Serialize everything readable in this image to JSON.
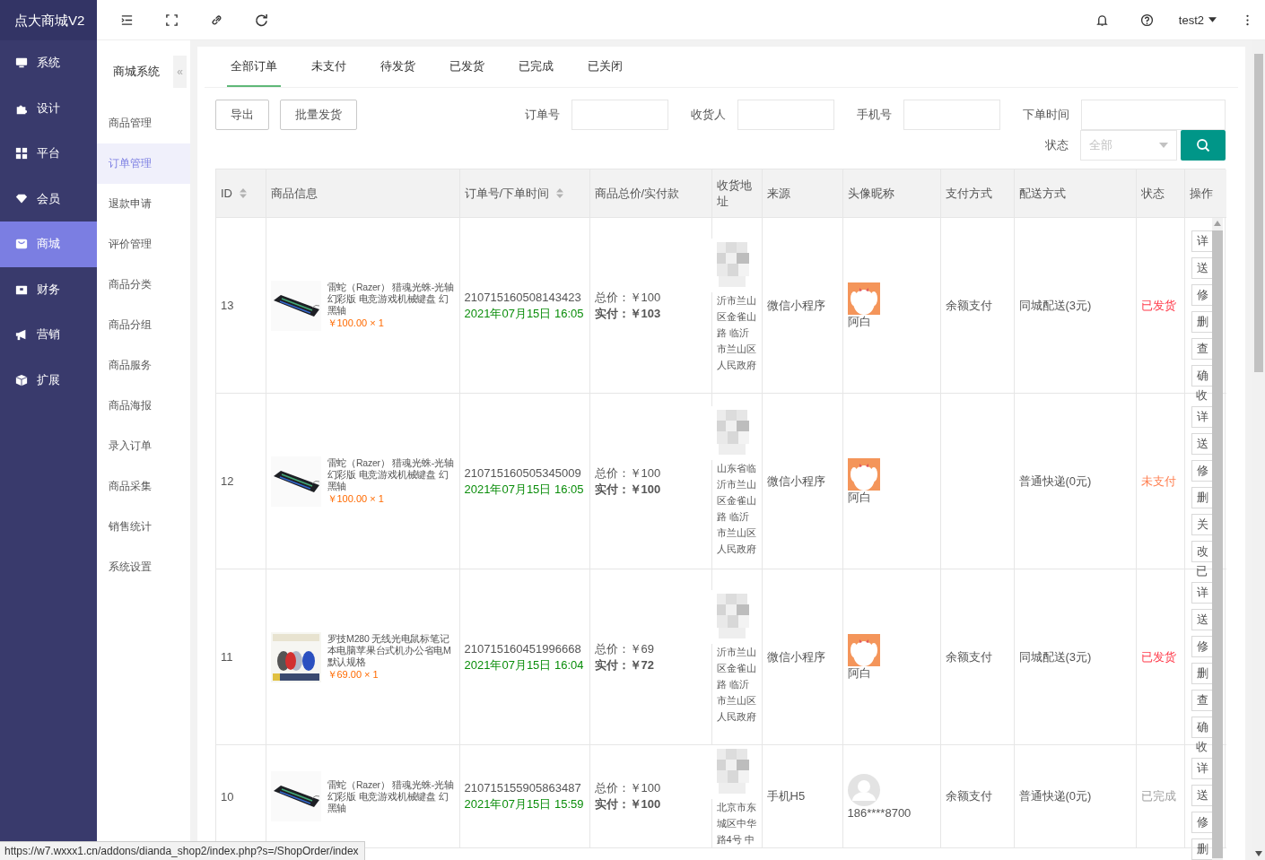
{
  "brand": "点大商城V2",
  "nav": [
    {
      "label": "系统",
      "selected": false
    },
    {
      "label": "设计",
      "selected": false
    },
    {
      "label": "平台",
      "selected": false
    },
    {
      "label": "会员",
      "selected": false
    },
    {
      "label": "商城",
      "selected": true
    },
    {
      "label": "财务",
      "selected": false
    },
    {
      "label": "营销",
      "selected": false
    },
    {
      "label": "扩展",
      "selected": false
    }
  ],
  "topbar": {
    "user": "test2"
  },
  "subnav": {
    "title": "商城系统",
    "collapse": "«",
    "items": [
      {
        "label": "商品管理",
        "selected": false
      },
      {
        "label": "订单管理",
        "selected": true
      },
      {
        "label": "退款申请",
        "selected": false
      },
      {
        "label": "评价管理",
        "selected": false
      },
      {
        "label": "商品分类",
        "selected": false
      },
      {
        "label": "商品分组",
        "selected": false
      },
      {
        "label": "商品服务",
        "selected": false
      },
      {
        "label": "商品海报",
        "selected": false
      },
      {
        "label": "录入订单",
        "selected": false
      },
      {
        "label": "商品采集",
        "selected": false
      },
      {
        "label": "销售统计",
        "selected": false
      },
      {
        "label": "系统设置",
        "selected": false
      }
    ]
  },
  "tabs": [
    {
      "label": "全部订单",
      "selected": true
    },
    {
      "label": "未支付",
      "selected": false
    },
    {
      "label": "待发货",
      "selected": false
    },
    {
      "label": "已发货",
      "selected": false
    },
    {
      "label": "已完成",
      "selected": false
    },
    {
      "label": "已关闭",
      "selected": false
    }
  ],
  "toolbar": {
    "buttons": [
      "导出",
      "批量发货"
    ]
  },
  "filters": [
    {
      "label": "订单号"
    },
    {
      "label": "收货人"
    },
    {
      "label": "手机号"
    },
    {
      "label": "下单时间"
    }
  ],
  "status_filter": {
    "label": "状态",
    "placeholder": "全部"
  },
  "table": {
    "columns": [
      {
        "label": "ID",
        "sortable": true
      },
      {
        "label": "商品信息",
        "sortable": false
      },
      {
        "label": "订单号/下单时间",
        "sortable": true
      },
      {
        "label": "商品总价/实付款",
        "sortable": false
      },
      {
        "label": "收货地址",
        "sortable": false
      },
      {
        "label": "来源",
        "sortable": false
      },
      {
        "label": "头像昵称",
        "sortable": false
      },
      {
        "label": "支付方式",
        "sortable": false
      },
      {
        "label": "配送方式",
        "sortable": false
      },
      {
        "label": "状态",
        "sortable": false
      },
      {
        "label": "操作",
        "sortable": false
      }
    ],
    "rows": [
      {
        "id": "13",
        "product": {
          "title": "雷蛇（Razer） 猎魂光蛛-光轴幻彩版 电竞游戏机械键盘 幻黑轴",
          "price": "￥100.00 × 1"
        },
        "order_no": "210715160508143423",
        "time": "2021年07月15日 16:05",
        "total": "总价：￥100",
        "paid": "实付：￥103",
        "address": "沂市兰山区金雀山路 临沂市兰山区人民政府",
        "source": "微信小程序",
        "avatar": {
          "kind": "picture"
        },
        "nickname": "阿白",
        "payment": "余额支付",
        "delivery": "同城配送(3元)",
        "status": {
          "text": "已发货",
          "color": "#ff3b4b"
        },
        "actions": [
          {
            "kind": "button",
            "label": "详"
          },
          {
            "kind": "button",
            "label": "送"
          },
          {
            "kind": "button",
            "label": "修"
          },
          {
            "kind": "button",
            "label": "删"
          },
          {
            "kind": "button",
            "label": "查"
          },
          {
            "kind": "button",
            "label": "确"
          },
          {
            "kind": "text",
            "label": "收"
          }
        ]
      },
      {
        "id": "12",
        "product": {
          "title": "雷蛇（Razer） 猎魂光蛛-光轴幻彩版 电竞游戏机械键盘 幻黑轴",
          "price": "￥100.00 × 1"
        },
        "order_no": "210715160505345009",
        "time": "2021年07月15日 16:05",
        "total": "总价：￥100",
        "paid": "实付：￥100",
        "address": "山东省临沂市兰山区金雀山路 临沂市兰山区人民政府",
        "source": "微信小程序",
        "avatar": {
          "kind": "picture"
        },
        "nickname": "阿白",
        "delivery": "普通快递(0元)",
        "status": {
          "text": "未支付",
          "color": "#ff7f50"
        },
        "actions": [
          {
            "kind": "button",
            "label": "详"
          },
          {
            "kind": "button",
            "label": "送"
          },
          {
            "kind": "button",
            "label": "修"
          },
          {
            "kind": "button",
            "label": "删"
          },
          {
            "kind": "button",
            "label": "关"
          },
          {
            "kind": "button",
            "label": "改"
          },
          {
            "kind": "text",
            "label": "已"
          }
        ]
      },
      {
        "id": "11",
        "product": {
          "title": "罗技M280 无线光电鼠标笔记本电脑苹果台式机办公省电M 默认规格",
          "price": "￥69.00 × 1"
        },
        "order_no": "210715160451996668",
        "time": "2021年07月15日 16:04",
        "total": "总价：￥69",
        "paid": "实付：￥72",
        "address": "沂市兰山区金雀山路 临沂市兰山区人民政府",
        "source": "微信小程序",
        "avatar": {
          "kind": "picture"
        },
        "nickname": "阿白",
        "payment": "余额支付",
        "delivery": "同城配送(3元)",
        "status": {
          "text": "已发货",
          "color": "#ff3b4b"
        },
        "actions": [
          {
            "kind": "button",
            "label": "详"
          },
          {
            "kind": "button",
            "label": "送"
          },
          {
            "kind": "button",
            "label": "修"
          },
          {
            "kind": "button",
            "label": "删"
          },
          {
            "kind": "button",
            "label": "查"
          },
          {
            "kind": "button",
            "label": "确"
          },
          {
            "kind": "text",
            "label": "收"
          }
        ]
      },
      {
        "id": "10",
        "product": {
          "title": "雷蛇（Razer） 猎魂光蛛-光轴幻彩版 电竞游戏机械键盘 幻黑轴"
        },
        "order_no": "210715155905863487",
        "time": "2021年07月15日 15:59",
        "total": "总价：￥100",
        "paid": "实付：￥100",
        "address": "北京市东城区中华路4号 中",
        "source": "手机H5",
        "avatar": {
          "kind": "placeholder"
        },
        "nickname": "186****8700",
        "payment": "余额支付",
        "delivery": "普通快递(0元)",
        "status": {
          "text": "已完成",
          "color": "#a0a0a0"
        },
        "actions": [
          {
            "kind": "button",
            "label": "详"
          },
          {
            "kind": "button",
            "label": "送"
          },
          {
            "kind": "button",
            "label": "修"
          },
          {
            "kind": "button",
            "label": "删"
          }
        ]
      }
    ]
  },
  "status_bar": "https://w7.wxxx1.cn/addons/dianda_shop2/index.php?s=/ShopOrder/index"
}
